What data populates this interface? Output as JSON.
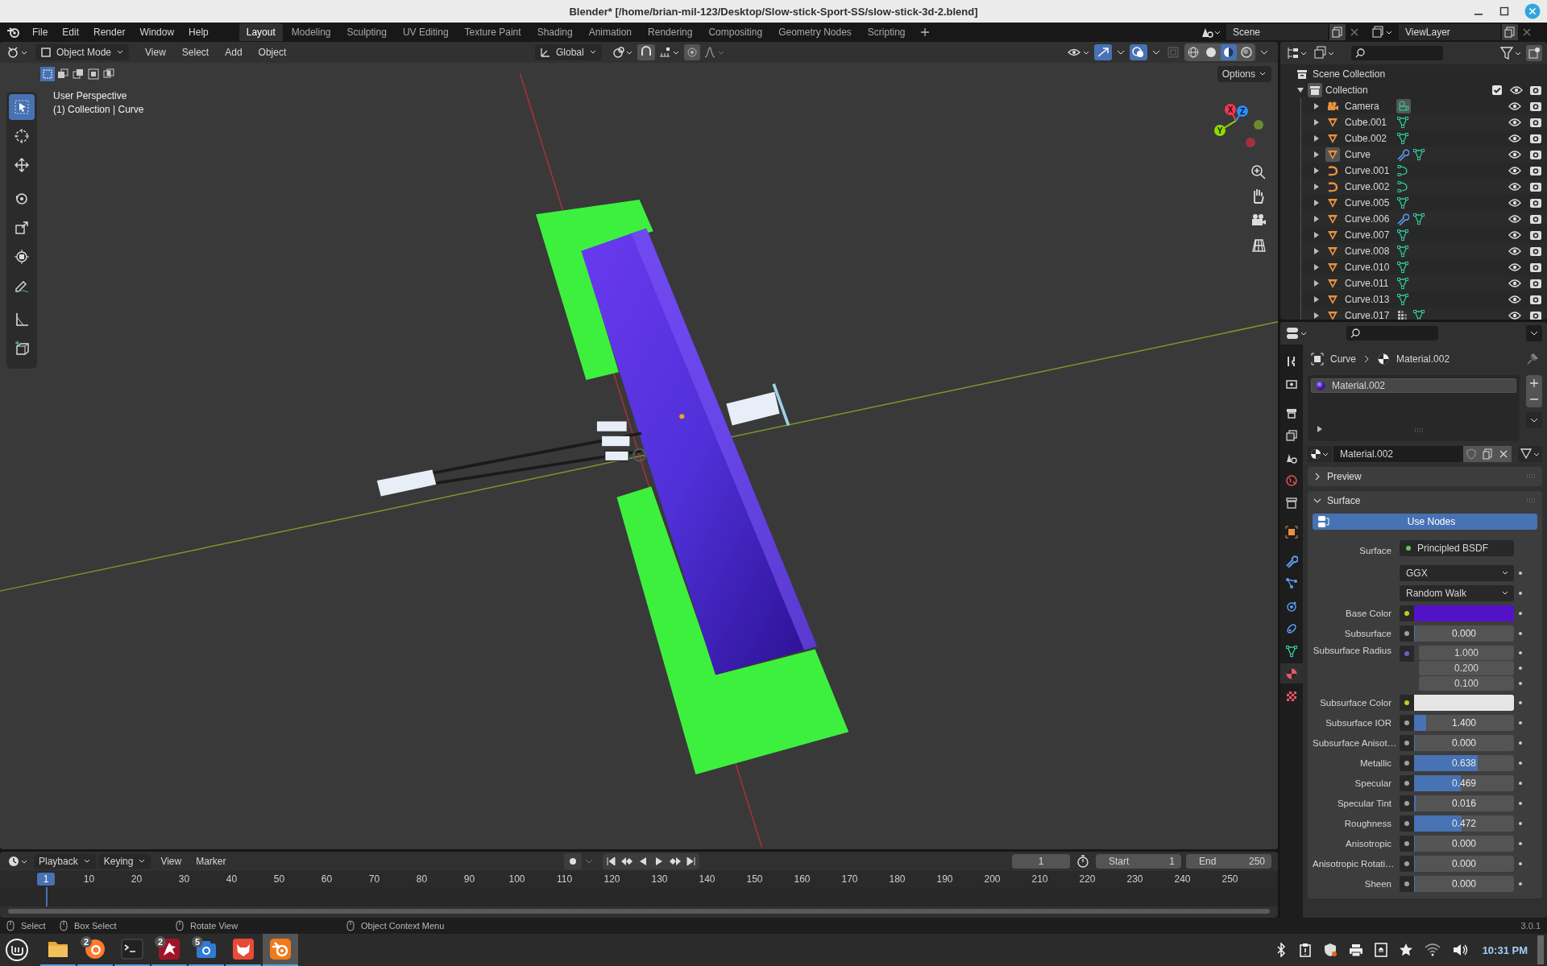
{
  "window": {
    "title": "Blender* [/home/brian-mil-123/Desktop/Slow-stick-Sport-SS/slow-stick-3d-2.blend]"
  },
  "menu": [
    "File",
    "Edit",
    "Render",
    "Window",
    "Help"
  ],
  "workspaces": [
    {
      "label": "Layout",
      "selected": true
    },
    {
      "label": "Modeling",
      "selected": false
    },
    {
      "label": "Sculpting",
      "selected": false
    },
    {
      "label": "UV Editing",
      "selected": false
    },
    {
      "label": "Texture Paint",
      "selected": false
    },
    {
      "label": "Shading",
      "selected": false
    },
    {
      "label": "Animation",
      "selected": false
    },
    {
      "label": "Rendering",
      "selected": false
    },
    {
      "label": "Compositing",
      "selected": false
    },
    {
      "label": "Geometry Nodes",
      "selected": false
    },
    {
      "label": "Scripting",
      "selected": false
    }
  ],
  "scene": {
    "name": "Scene"
  },
  "view_layer": {
    "name": "ViewLayer"
  },
  "viewport": {
    "mode": "Object Mode",
    "menu": [
      "View",
      "Select",
      "Add",
      "Object"
    ],
    "orientation": "Global",
    "options": "Options",
    "info": [
      "User Perspective",
      "(1) Collection | Curve"
    ],
    "gizmo": [
      {
        "label": "X",
        "color": "#ff3352"
      },
      {
        "label": "Y",
        "color": "#8bdc00"
      },
      {
        "label": "Z",
        "color": "#2890ff"
      }
    ],
    "tools": [
      {
        "kind": "select",
        "selected": true
      },
      {
        "kind": "cursor",
        "selected": false
      },
      {
        "kind": "move",
        "selected": false
      },
      {
        "kind": "rotate",
        "selected": false
      },
      {
        "kind": "scale",
        "selected": false
      },
      {
        "kind": "transform",
        "selected": false
      },
      {
        "kind": "annotate",
        "selected": false
      },
      {
        "kind": "measure",
        "selected": false
      },
      {
        "kind": "add-cube",
        "selected": false
      }
    ]
  },
  "outliner": {
    "root": "Scene Collection",
    "collection": {
      "name": "Collection",
      "expanded": true,
      "checked": true,
      "children": [
        {
          "name": "Camera",
          "kind": "camera",
          "selected": false,
          "badges": [
            {
              "kind": "camera-data"
            }
          ]
        },
        {
          "name": "Cube.001",
          "kind": "mesh",
          "selected": false,
          "badges": [
            {
              "kind": "mesh"
            }
          ]
        },
        {
          "name": "Cube.002",
          "kind": "mesh",
          "selected": false,
          "badges": [
            {
              "kind": "mesh"
            }
          ]
        },
        {
          "name": "Curve",
          "kind": "mesh",
          "selected": true,
          "badges": [
            {
              "kind": "wrench"
            },
            {
              "kind": "mesh"
            }
          ]
        },
        {
          "name": "Curve.001",
          "kind": "curve",
          "selected": false,
          "badges": [
            {
              "kind": "curve"
            }
          ]
        },
        {
          "name": "Curve.002",
          "kind": "curve",
          "selected": false,
          "badges": [
            {
              "kind": "curve"
            }
          ]
        },
        {
          "name": "Curve.005",
          "kind": "mesh",
          "selected": false,
          "badges": [
            {
              "kind": "mesh"
            }
          ]
        },
        {
          "name": "Curve.006",
          "kind": "mesh",
          "selected": false,
          "badges": [
            {
              "kind": "wrench"
            },
            {
              "kind": "mesh"
            }
          ]
        },
        {
          "name": "Curve.007",
          "kind": "mesh",
          "selected": false,
          "badges": [
            {
              "kind": "mesh"
            }
          ]
        },
        {
          "name": "Curve.008",
          "kind": "mesh",
          "selected": false,
          "badges": [
            {
              "kind": "mesh"
            }
          ]
        },
        {
          "name": "Curve.010",
          "kind": "mesh",
          "selected": false,
          "badges": [
            {
              "kind": "mesh"
            }
          ]
        },
        {
          "name": "Curve.011",
          "kind": "mesh",
          "selected": false,
          "badges": [
            {
              "kind": "mesh"
            }
          ]
        },
        {
          "name": "Curve.013",
          "kind": "mesh",
          "selected": false,
          "badges": [
            {
              "kind": "mesh"
            }
          ]
        },
        {
          "name": "Curve.017",
          "kind": "mesh",
          "selected": false,
          "badges": [
            {
              "kind": "grid"
            },
            {
              "kind": "mesh"
            }
          ]
        }
      ]
    }
  },
  "properties": {
    "tabs": [
      {
        "kind": "tool",
        "selected": false
      },
      {
        "kind": "render",
        "selected": false
      },
      {
        "kind": "output",
        "selected": false
      },
      {
        "kind": "view-layer",
        "selected": false
      },
      {
        "kind": "scene",
        "selected": false
      },
      {
        "kind": "world",
        "selected": false
      },
      {
        "kind": "collection",
        "selected": false
      },
      {
        "kind": "object",
        "selected": false
      },
      {
        "kind": "modifier",
        "selected": false
      },
      {
        "kind": "particles",
        "selected": false
      },
      {
        "kind": "physics",
        "selected": false
      },
      {
        "kind": "constraints",
        "selected": false
      },
      {
        "kind": "data",
        "selected": false
      },
      {
        "kind": "material",
        "selected": true
      },
      {
        "kind": "texture",
        "selected": false
      }
    ],
    "breadcrumb": [
      "Curve",
      "Material.002"
    ],
    "slots": [
      {
        "name": "Material.002",
        "selected": true
      }
    ],
    "material": "Material.002",
    "panels": [
      {
        "label": "Preview",
        "expanded": false
      },
      {
        "label": "Surface",
        "expanded": true
      }
    ],
    "use_nodes": "Use Nodes",
    "surface": {
      "label": "Surface",
      "value": "Principled BSDF"
    },
    "dropdowns": [
      "GGX",
      "Random Walk"
    ],
    "fields": [
      {
        "label": "Base Color",
        "kind": "color",
        "color": "#5412c8"
      },
      {
        "label": "Subsurface",
        "kind": "value",
        "value": "0.000",
        "level": 0
      },
      {
        "label": "Subsurface Radius",
        "kind": "vector",
        "values": [
          "1.000",
          "0.200",
          "0.100"
        ]
      },
      {
        "label": "Subsurface Color",
        "kind": "color",
        "color": "#e6e6e6"
      },
      {
        "label": "Subsurface IOR",
        "kind": "value",
        "value": "1.400",
        "level": 0.12
      },
      {
        "label": "Subsurface Anisot…",
        "kind": "value",
        "value": "0.000",
        "level": 0
      },
      {
        "label": "Metallic",
        "kind": "value",
        "value": "0.638",
        "level": 0.638
      },
      {
        "label": "Specular",
        "kind": "value",
        "value": "0.469",
        "level": 0.469
      },
      {
        "label": "Specular Tint",
        "kind": "value",
        "value": "0.016",
        "level": 0.016
      },
      {
        "label": "Roughness",
        "kind": "value",
        "value": "0.472",
        "level": 0.472
      },
      {
        "label": "Anisotropic",
        "kind": "value",
        "value": "0.000",
        "level": 0
      },
      {
        "label": "Anisotropic Rotati…",
        "kind": "value",
        "value": "0.000",
        "level": 0
      },
      {
        "label": "Sheen",
        "kind": "value",
        "value": "0.000",
        "level": 0
      }
    ]
  },
  "timeline": {
    "dropdowns": [
      "Playback",
      "Keying"
    ],
    "menu": [
      "View",
      "Marker"
    ],
    "frame": "1",
    "start_label": "Start",
    "start": "1",
    "end_label": "End",
    "end": "250",
    "current": "1",
    "ticks": [
      "10",
      "20",
      "30",
      "40",
      "50",
      "60",
      "70",
      "80",
      "90",
      "100",
      "110",
      "120",
      "130",
      "140",
      "150",
      "160",
      "170",
      "180",
      "190",
      "200",
      "210",
      "220",
      "230",
      "240",
      "250"
    ]
  },
  "status_bar": {
    "hints": [
      "Select",
      "Box Select",
      "Rotate View",
      "Object Context Menu"
    ],
    "version": "3.0.1"
  },
  "taskbar": {
    "apps": [
      {
        "kind": "files",
        "selected": false
      },
      {
        "kind": "browser",
        "badge": "2",
        "selected": false
      },
      {
        "kind": "terminal",
        "selected": false
      },
      {
        "kind": "dragon",
        "badge": "2",
        "selected": false
      },
      {
        "kind": "camera",
        "badge": "5",
        "selected": false
      },
      {
        "kind": "painter",
        "selected": false
      },
      {
        "kind": "blender",
        "selected": true
      }
    ],
    "clock": "10:31 PM"
  }
}
